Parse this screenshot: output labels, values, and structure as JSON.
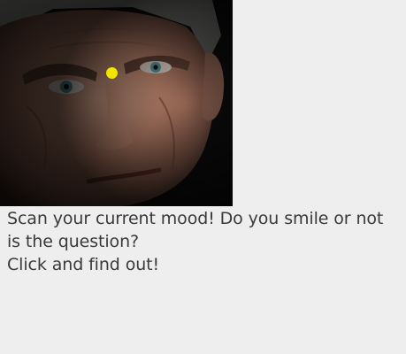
{
  "image": {
    "subject": "face-photo",
    "marker_color": "#f2e600"
  },
  "message": {
    "line1": "Scan your current mood! Do you smile or not",
    "line2": "is the question?",
    "line3": "Click and find out!"
  },
  "colors": {
    "background": "#eeeeee",
    "text": "#3a3a3a"
  }
}
